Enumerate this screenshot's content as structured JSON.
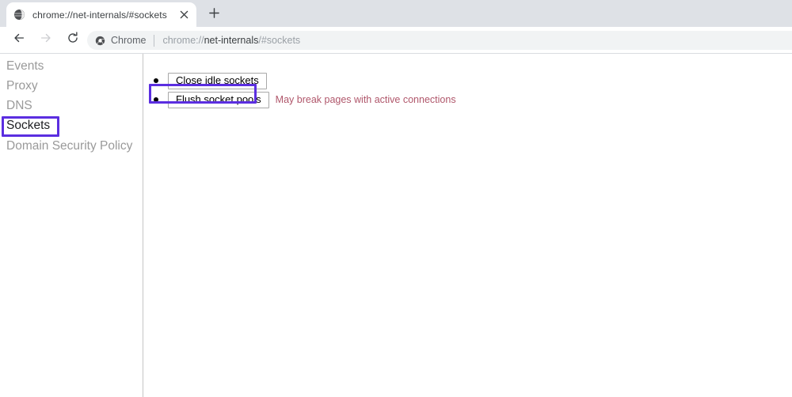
{
  "browser": {
    "tab": {
      "favicon": "globe-icon",
      "title": "chrome://net-internals/#sockets",
      "close_label": "✕"
    },
    "new_tab_label": "+",
    "nav": {
      "back_label": "←",
      "forward_label": "→",
      "reload_label": "↻"
    },
    "omnibox": {
      "chip_icon": "chrome-logo-icon",
      "chip_label": "Chrome",
      "url_prefix": "chrome://",
      "url_host": "net-internals",
      "url_suffix": "/#sockets",
      "full_url": "chrome://net-internals/#sockets"
    }
  },
  "sidebar": {
    "items": [
      {
        "label": "Events",
        "selected": false
      },
      {
        "label": "Proxy",
        "selected": false
      },
      {
        "label": "DNS",
        "selected": false
      },
      {
        "label": "Sockets",
        "selected": true
      },
      {
        "label": "Domain Security Policy",
        "selected": false
      }
    ]
  },
  "main": {
    "actions": [
      {
        "label": "Close idle sockets",
        "note": "",
        "highlighted": false
      },
      {
        "label": "Flush socket pools",
        "note": "May break pages with active connections",
        "highlighted": true
      }
    ]
  },
  "colors": {
    "highlight": "#5b2ee0",
    "warning_text": "#b0576b",
    "tabstrip_bg": "#dee1e6",
    "omnibox_bg": "#f1f3f4",
    "sidebar_text": "#9a9a9a",
    "selected_text": "#202124"
  }
}
